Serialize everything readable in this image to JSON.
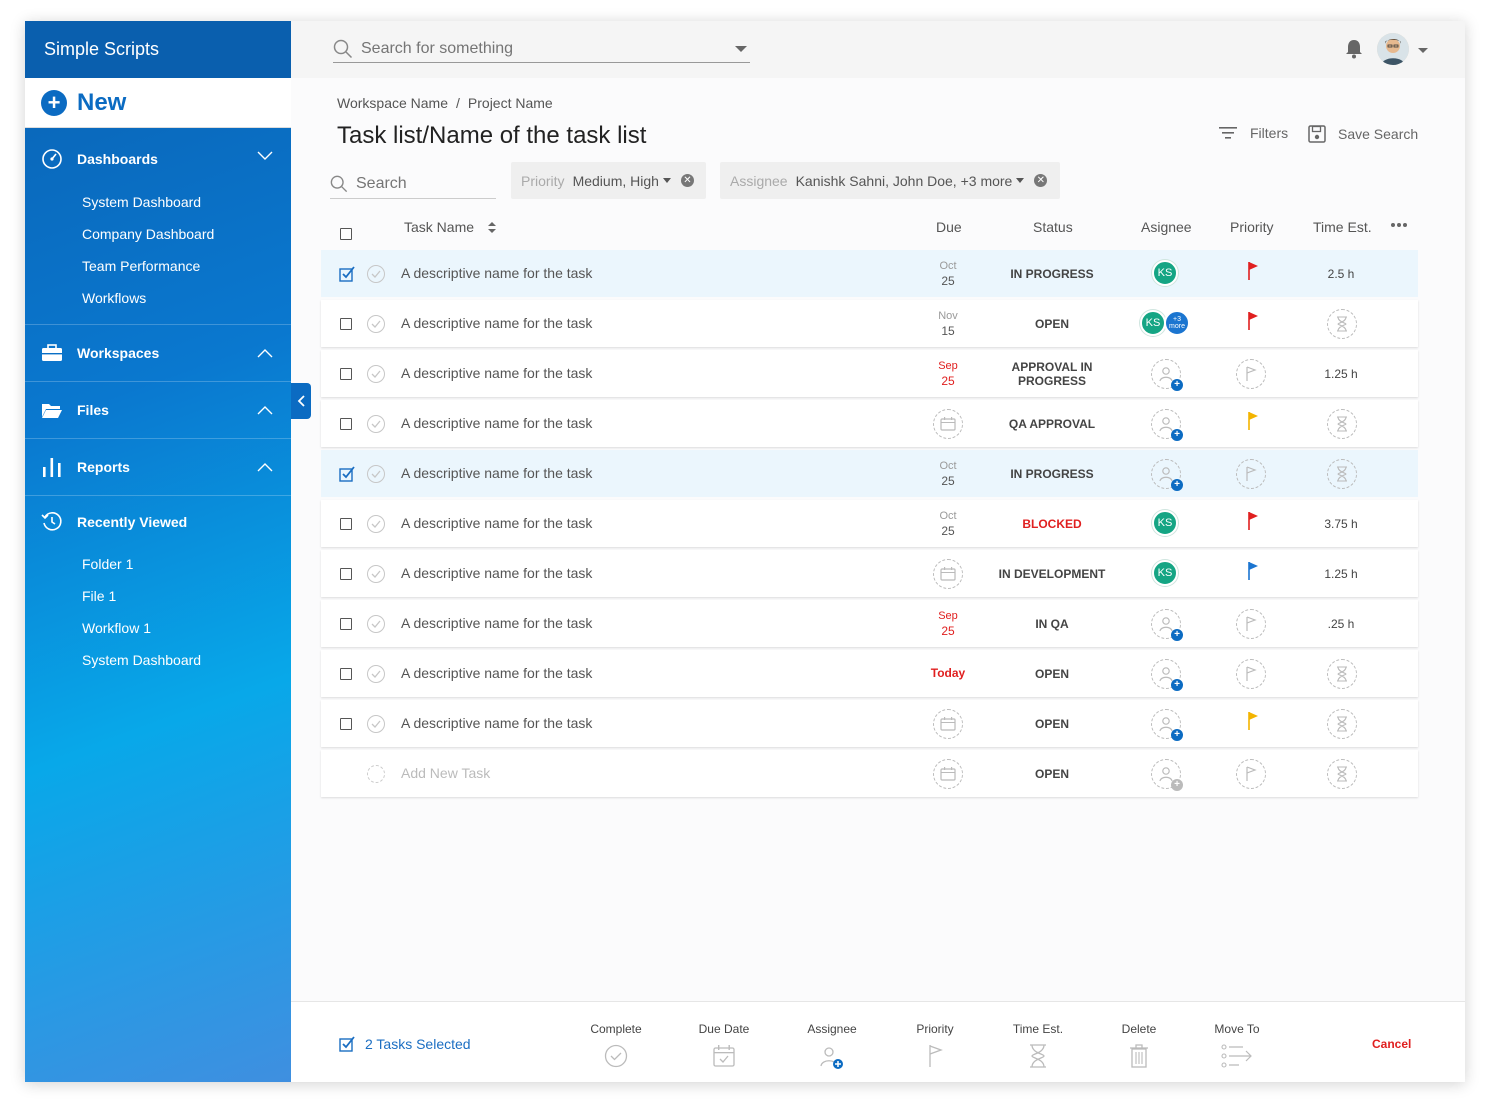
{
  "app": {
    "title": "Simple Scripts"
  },
  "new_button": {
    "label": "New"
  },
  "sidebar": {
    "dashboards": {
      "label": "Dashboards",
      "items": [
        "System Dashboard",
        "Company Dashboard",
        "Team Performance",
        "Workflows"
      ]
    },
    "workspaces": {
      "label": "Workspaces"
    },
    "files": {
      "label": "Files"
    },
    "reports": {
      "label": "Reports"
    },
    "recently_viewed": {
      "label": "Recently Viewed",
      "items": [
        "Folder 1",
        "File 1",
        "Workflow 1",
        "System Dashboard"
      ]
    }
  },
  "topbar": {
    "search_placeholder": "Search for something"
  },
  "breadcrumb": {
    "workspace": "Workspace Name",
    "separator": "/",
    "project": "Project Name"
  },
  "page": {
    "title": "Task list/Name of the task list"
  },
  "toolbar": {
    "filters_label": "Filters",
    "save_search_label": "Save Search"
  },
  "list_search": {
    "placeholder": "Search"
  },
  "filter_chips": {
    "priority": {
      "key": "Priority",
      "value": "Medium, High"
    },
    "assignee": {
      "key": "Assignee",
      "value": "Kanishk Sahni, John Doe, +3 more"
    }
  },
  "columns": {
    "task_name": "Task Name",
    "due": "Due",
    "status": "Status",
    "assignee": "Asignee",
    "priority": "Priority",
    "time_est": "Time Est."
  },
  "colors": {
    "accent": "#0b6bc2",
    "red": "#e02020",
    "yellow": "#f3b400",
    "blue_flag": "#1b75d0",
    "avatar_green": "#15a584"
  },
  "tasks": [
    {
      "selected": true,
      "name": "A descriptive name for the task",
      "due_month": "Oct",
      "due_day": "25",
      "due_style": "normal",
      "status": "IN PROGRESS",
      "assignee": "KS",
      "assignee_more": "",
      "priority": "red-flag",
      "time": "2.5 h"
    },
    {
      "selected": false,
      "name": "A descriptive name for the task",
      "due_month": "Nov",
      "due_day": "15",
      "due_style": "normal",
      "status": "OPEN",
      "assignee": "KS",
      "assignee_more": "+3 more",
      "priority": "red-flag",
      "time": ""
    },
    {
      "selected": false,
      "name": "A descriptive name for the task",
      "due_month": "Sep",
      "due_day": "25",
      "due_style": "late",
      "status": "APPROVAL IN PROGRESS",
      "assignee": "",
      "assignee_more": "",
      "priority": "empty",
      "time": "1.25 h"
    },
    {
      "selected": false,
      "name": "A descriptive name for the task",
      "due_month": "",
      "due_day": "",
      "due_style": "empty",
      "status": "QA APPROVAL",
      "assignee": "",
      "assignee_more": "",
      "priority": "yellow-flag",
      "time": ""
    },
    {
      "selected": true,
      "name": "A descriptive name for the task",
      "due_month": "Oct",
      "due_day": "25",
      "due_style": "normal",
      "status": "IN PROGRESS",
      "assignee": "",
      "assignee_more": "",
      "priority": "empty",
      "time": ""
    },
    {
      "selected": false,
      "name": "A descriptive name for the task",
      "due_month": "Oct",
      "due_day": "25",
      "due_style": "normal",
      "status": "BLOCKED",
      "assignee": "KS",
      "assignee_more": "",
      "priority": "red-flag",
      "time": "3.75 h"
    },
    {
      "selected": false,
      "name": "A descriptive name for the task",
      "due_month": "",
      "due_day": "",
      "due_style": "empty",
      "status": "IN DEVELOPMENT",
      "assignee": "KS",
      "assignee_more": "",
      "priority": "blue-flag",
      "time": "1.25 h"
    },
    {
      "selected": false,
      "name": "A descriptive name for the task",
      "due_month": "Sep",
      "due_day": "25",
      "due_style": "late",
      "status": "IN QA",
      "assignee": "",
      "assignee_more": "",
      "priority": "empty",
      "time": ".25 h"
    },
    {
      "selected": false,
      "name": "A descriptive name for the task",
      "due_month": "",
      "due_day": "Today",
      "due_style": "today",
      "status": "OPEN",
      "assignee": "",
      "assignee_more": "",
      "priority": "empty",
      "time": ""
    },
    {
      "selected": false,
      "name": "A descriptive name for the task",
      "due_month": "",
      "due_day": "",
      "due_style": "empty",
      "status": "OPEN",
      "assignee": "",
      "assignee_more": "",
      "priority": "yellow-flag",
      "time": ""
    }
  ],
  "add_row": {
    "placeholder": "Add New Task",
    "status": "OPEN"
  },
  "bottom_bar": {
    "selected_label": "2 Tasks Selected",
    "actions": [
      "Complete",
      "Due Date",
      "Assignee",
      "Priority",
      "Time Est.",
      "Delete",
      "Move To"
    ],
    "cancel_label": "Cancel"
  }
}
